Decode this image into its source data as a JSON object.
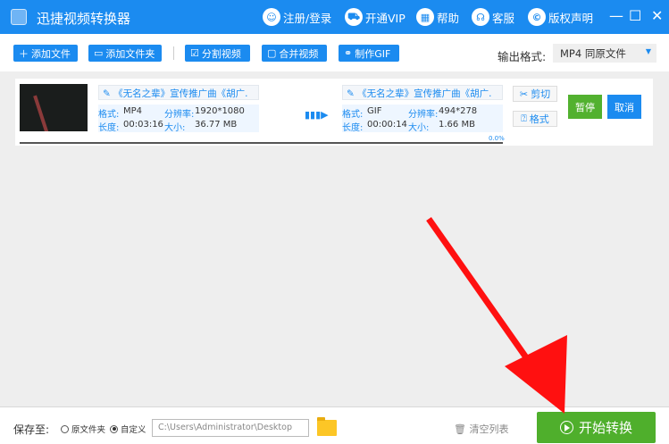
{
  "app": {
    "title": "迅捷视频转换器"
  },
  "titlenav": [
    {
      "label": "注册/登录",
      "icon": "user-icon"
    },
    {
      "label": "开通VIP",
      "icon": "cart-icon"
    },
    {
      "label": "帮助",
      "icon": "grid-icon"
    },
    {
      "label": "客服",
      "icon": "headset-icon"
    },
    {
      "label": "版权声明",
      "icon": "copyright-icon"
    }
  ],
  "toolbar": {
    "add_file": "添加文件",
    "add_folder": "添加文件夹",
    "split": "分割视频",
    "merge": "合并视频",
    "gif": "制作GIF",
    "format_label": "输出格式:",
    "format_value": "MP4  同原文件"
  },
  "file": {
    "source": {
      "name": "《无名之辈》宣传推广曲《胡广.",
      "format_label": "格式:",
      "format": "MP4",
      "res_label": "分辨率:",
      "resolution": "1920*1080",
      "dur_label": "长度:",
      "duration": "00:03:16",
      "size_label": "大小:",
      "size": "36.77 MB"
    },
    "target": {
      "name": "《无名之辈》宣传推广曲《胡广.",
      "format_label": "格式:",
      "format": "GIF",
      "res_label": "分辨率:",
      "resolution": "494*278",
      "dur_label": "长度:",
      "duration": "00:00:14",
      "size_label": "大小:",
      "size": "1.66 MB"
    },
    "progress_text": "0.0%",
    "progress": 0,
    "cut": "剪切",
    "format_btn": "格式",
    "pause": "暂停",
    "cancel": "取消"
  },
  "bottom": {
    "save_label": "保存至:",
    "opt_original": "原文件夹",
    "opt_custom": "自定义",
    "path": "C:\\Users\\Administrator\\Desktop",
    "clear": "清空列表",
    "start": "开始转换"
  }
}
